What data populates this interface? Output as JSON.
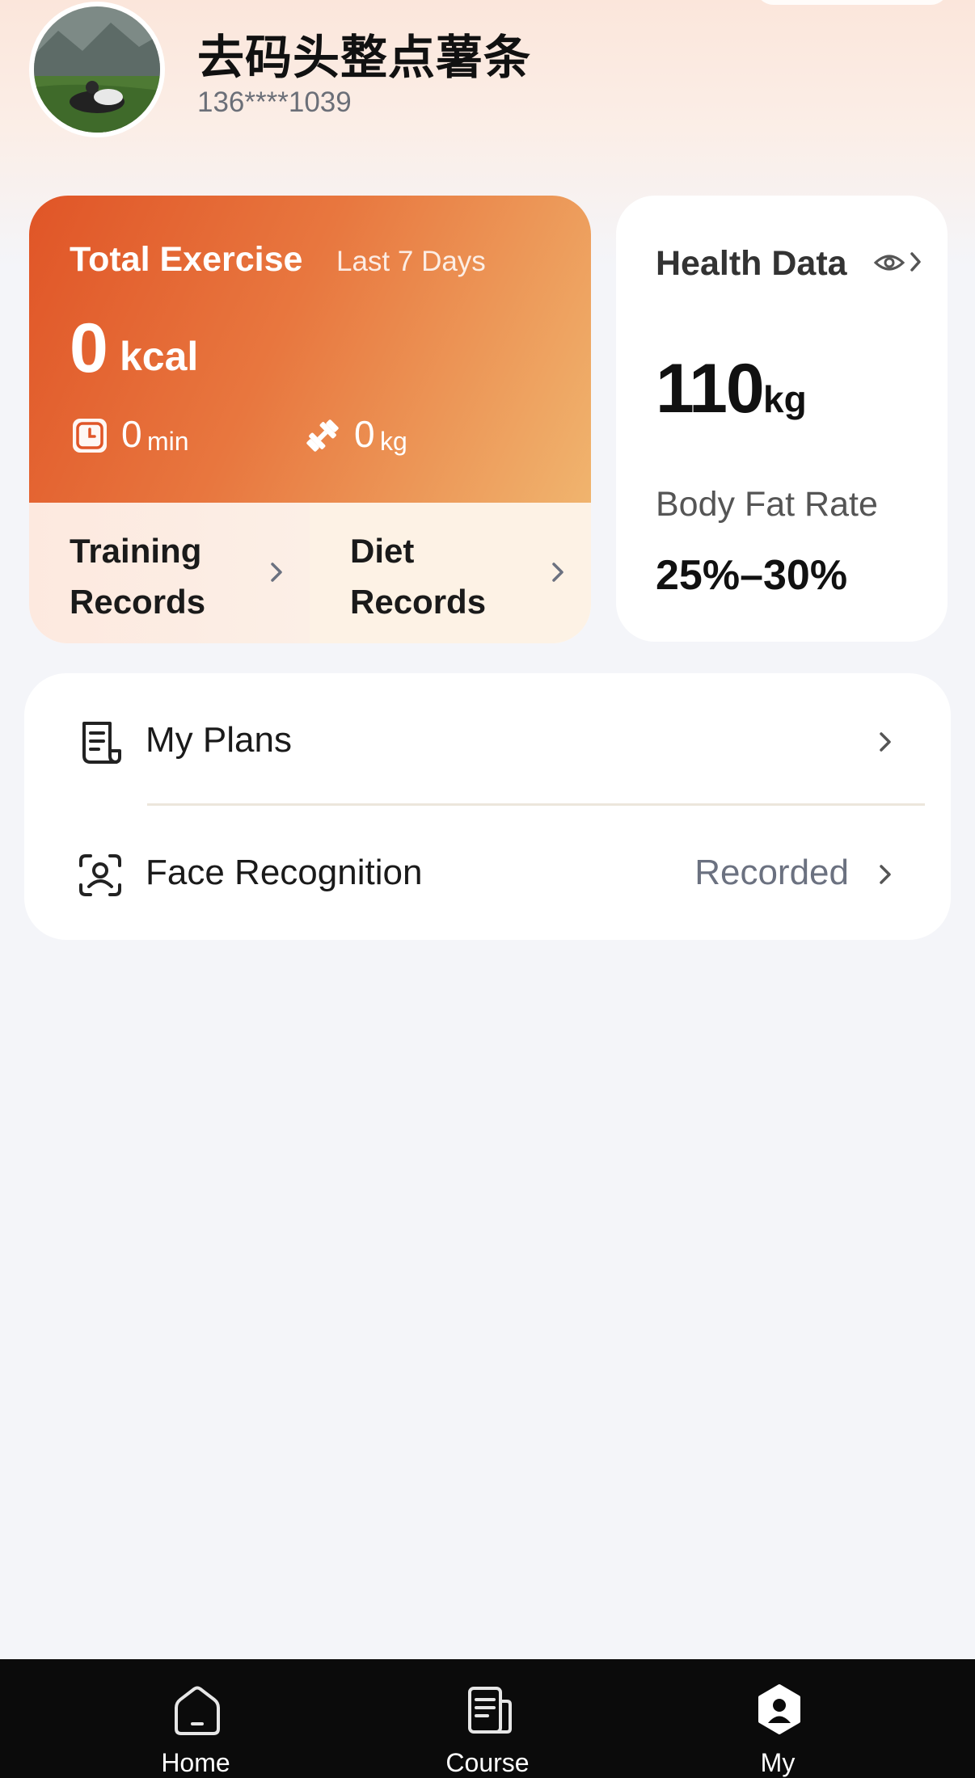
{
  "profile": {
    "username": "去码头整点薯条",
    "phone": "136****1039"
  },
  "exercise": {
    "title": "Total Exercise",
    "period": "Last 7 Days",
    "calories_value": "0",
    "calories_unit": "kcal",
    "duration_value": "0",
    "duration_unit": "min",
    "weight_value": "0",
    "weight_unit": "kg",
    "training_records_label": "Training Records",
    "diet_records_label": "Diet Records"
  },
  "health": {
    "title": "Health Data",
    "weight_value": "110",
    "weight_unit": "kg",
    "body_fat_label": "Body Fat Rate",
    "body_fat_value": "25%–30%"
  },
  "menu": {
    "items": [
      {
        "label": "My Plans",
        "value": "",
        "icon": "document-icon"
      },
      {
        "label": "Face Recognition",
        "value": "Recorded",
        "icon": "face-scan-icon"
      }
    ]
  },
  "tabbar": {
    "tabs": [
      {
        "label": "Home",
        "icon": "home-icon",
        "active": false
      },
      {
        "label": "Course",
        "icon": "course-icon",
        "active": false
      },
      {
        "label": "My",
        "icon": "profile-icon",
        "active": true
      }
    ]
  },
  "colors": {
    "accent_orange": "#e05527",
    "accent_light": "#f0b46e",
    "tabbar_bg": "#0b0b0b",
    "page_bg": "#f4f5f9"
  }
}
